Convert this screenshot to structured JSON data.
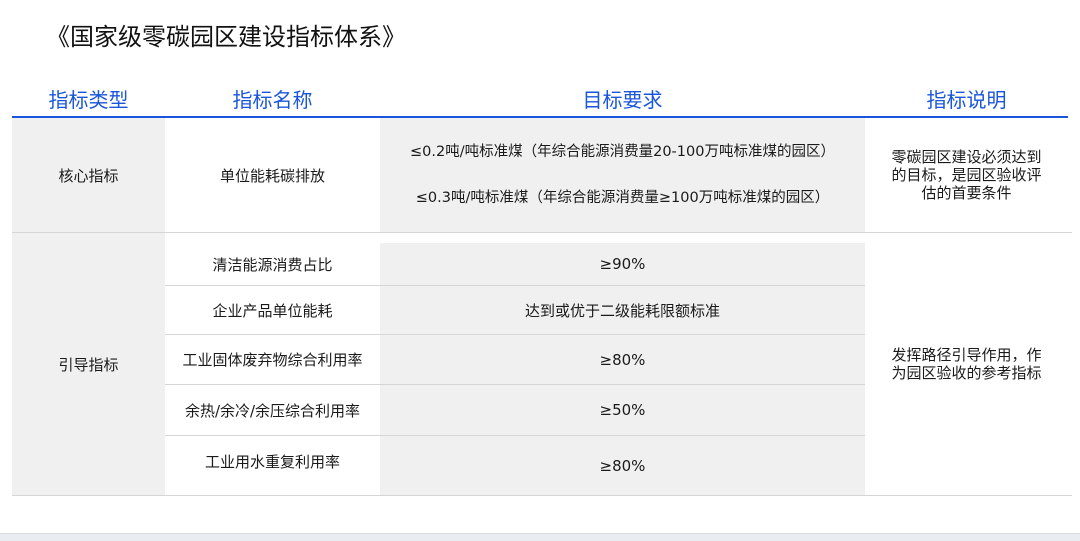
{
  "title": "《国家级零碳园区建设指标体系》",
  "headers": {
    "type": "指标类型",
    "name": "指标名称",
    "requirement": "目标要求",
    "description": "指标说明"
  },
  "core": {
    "type": "核心指标",
    "name": "单位能耗碳排放",
    "requirements": [
      "≤0.2吨/吨标准煤（年综合能源消费量20-100万吨标准煤的园区）",
      "≤0.3吨/吨标准煤（年综合能源消费量≥100万吨标准煤的园区）"
    ],
    "description": "零碳园区建设必须达到的目标，是园区验收评估的首要条件"
  },
  "guide": {
    "type": "引导指标",
    "description": "发挥路径引导作用，作为园区验收的参考指标",
    "rows": [
      {
        "name": "清洁能源消费占比",
        "requirement": "≥90%"
      },
      {
        "name": "企业产品单位能耗",
        "requirement": "达到或优于二级能耗限额标准"
      },
      {
        "name": "工业固体废弃物综合利用率",
        "requirement": "≥80%"
      },
      {
        "name": "余热/余冷/余压综合利用率",
        "requirement": "≥50%"
      },
      {
        "name": "工业用水重复利用率",
        "requirement": "≥80%"
      }
    ]
  },
  "colors": {
    "header_text": "#1a56db",
    "header_line": "#1a56db",
    "grey_cell": "#f0f0f0"
  }
}
